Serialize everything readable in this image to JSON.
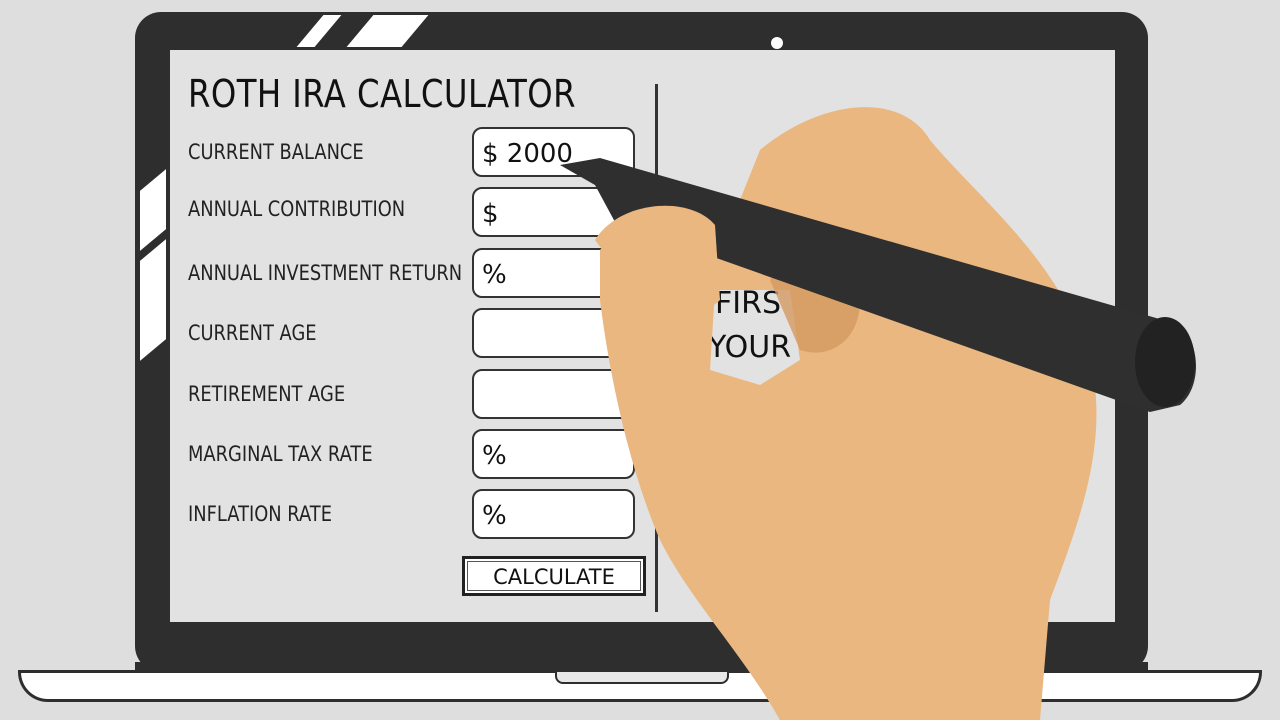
{
  "calculator": {
    "title": "ROTH IRA CALCULATOR",
    "fields": [
      {
        "label": "CURRENT BALANCE",
        "value": "$ 2000"
      },
      {
        "label": "ANNUAL CONTRIBUTION",
        "value": "$"
      },
      {
        "label": "ANNUAL INVESTMENT RETURN",
        "value": "%"
      },
      {
        "label": "CURRENT AGE",
        "value": ""
      },
      {
        "label": "RETIREMENT AGE",
        "value": ""
      },
      {
        "label": "MARGINAL TAX RATE",
        "value": "%"
      },
      {
        "label": "INFLATION RATE",
        "value": "%"
      }
    ],
    "calculate_label": "CALCULATE"
  },
  "results": {
    "line1": "FIRS",
    "line2": "YOUR C"
  },
  "colors": {
    "bezel": "#2e2e2e",
    "screen": "#e2e2e2",
    "skin": "#e9b77f",
    "pen": "#2f2f2f"
  }
}
